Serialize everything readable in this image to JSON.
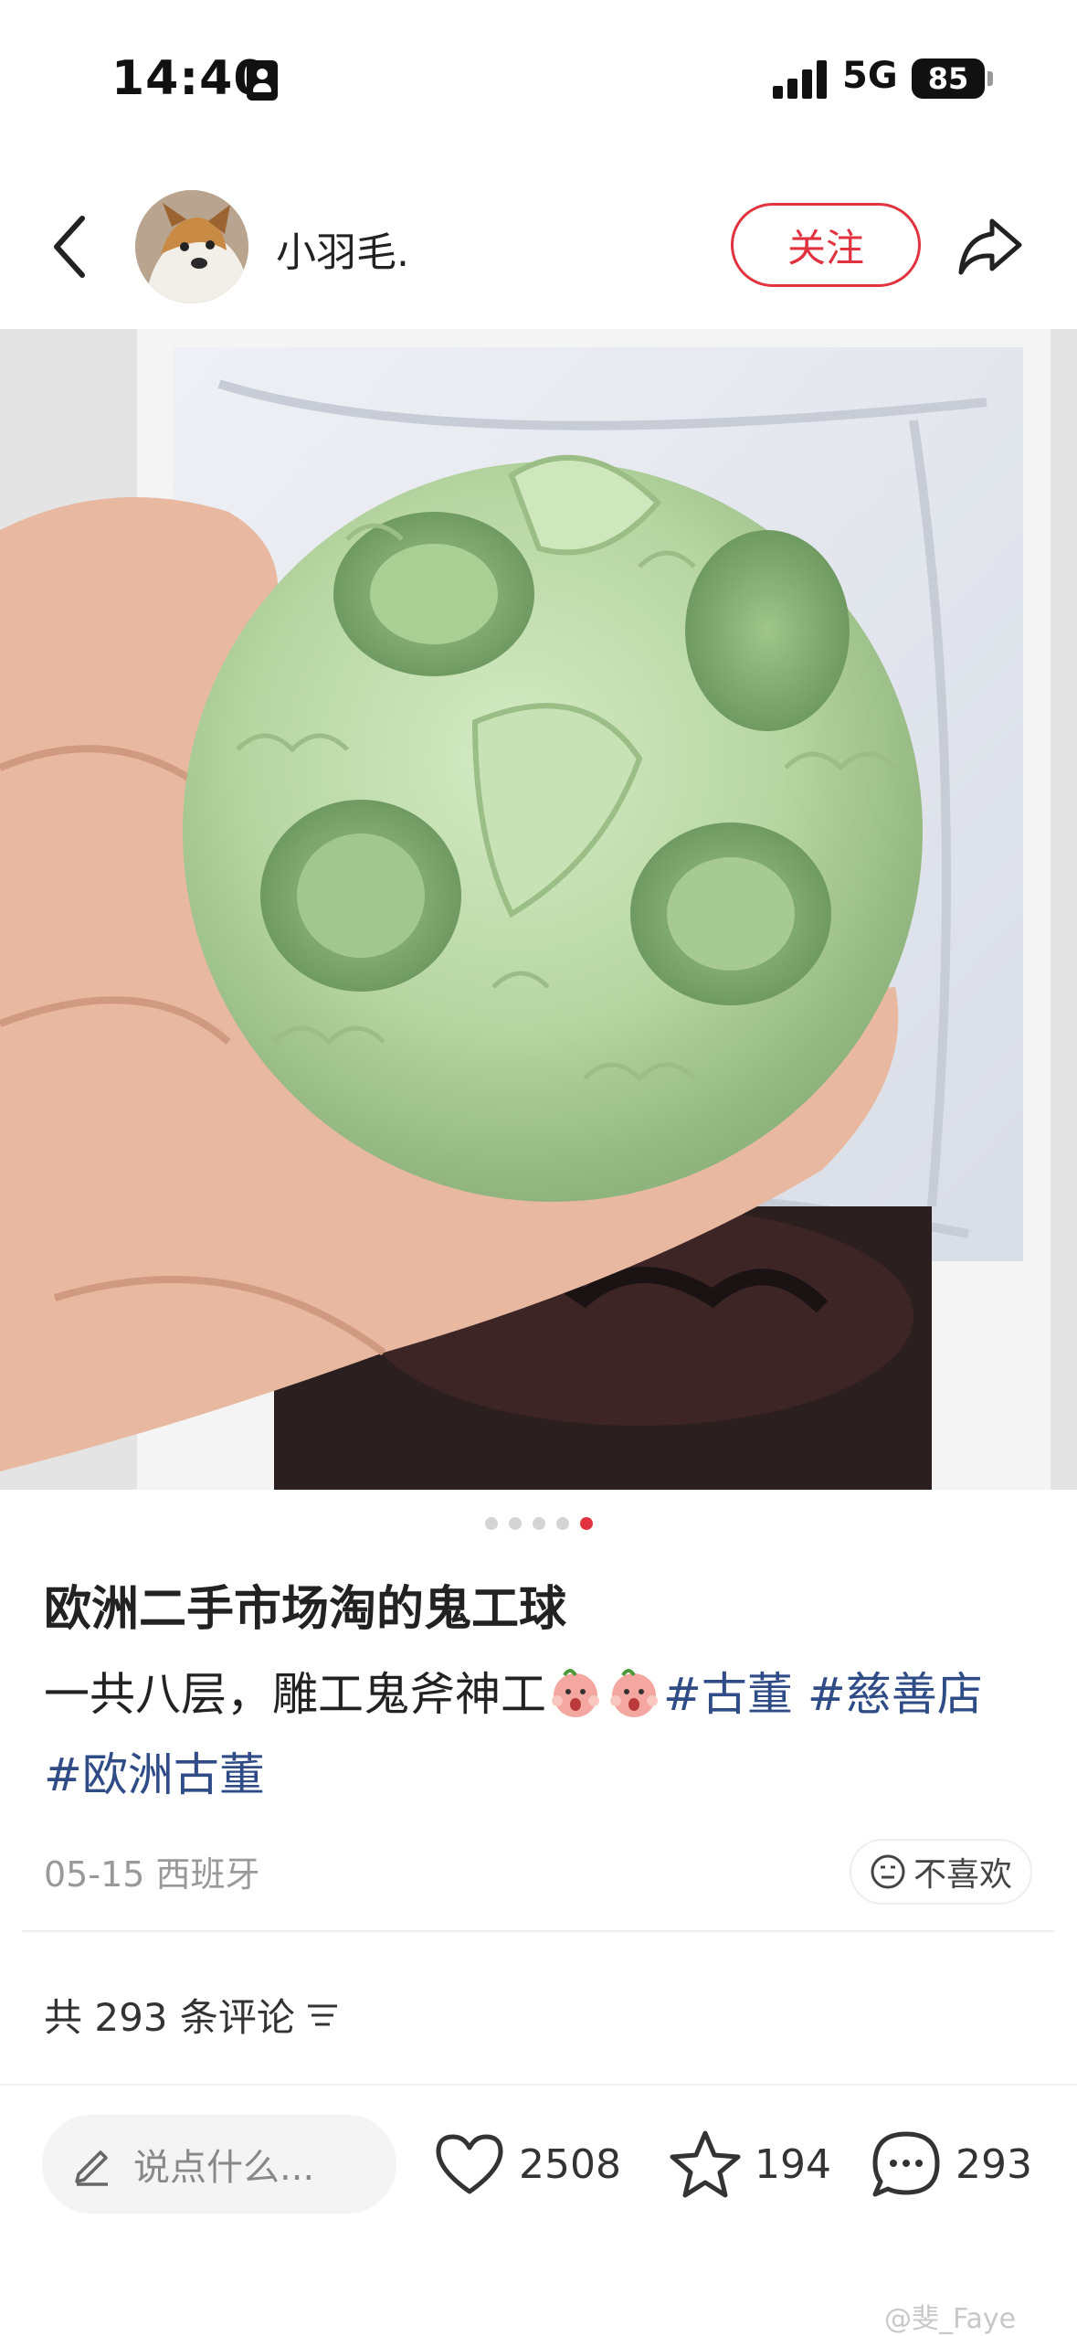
{
  "status_bar": {
    "time": "14:40",
    "network": "5G",
    "battery": "85"
  },
  "header": {
    "author": "小羽毛.",
    "follow_label": "关注"
  },
  "post": {
    "title": "欧洲二手市场淘的鬼工球",
    "desc_text": "一共八层，雕工鬼斧神工",
    "tags": [
      "#古董",
      "#慈善店",
      "#欧洲古董"
    ],
    "date_location": "05-15 西班牙",
    "dislike_label": "不喜欢",
    "image_count": 5,
    "active_image": 5
  },
  "comments": {
    "count_label": "共 293 条评论"
  },
  "bottom_bar": {
    "input_placeholder": "说点什么...",
    "likes": "2508",
    "collects": "194",
    "comments": "293"
  },
  "watermark": "@斐_Faye",
  "icons": [
    "id-card-icon",
    "signal-icon",
    "back-icon",
    "share-icon",
    "dislike-face-icon",
    "sort-icon",
    "pencil-icon",
    "heart-icon",
    "star-icon",
    "comment-icon"
  ],
  "colors": {
    "accent": "#e0333f",
    "tag": "#2f4c87",
    "muted": "#999999"
  }
}
